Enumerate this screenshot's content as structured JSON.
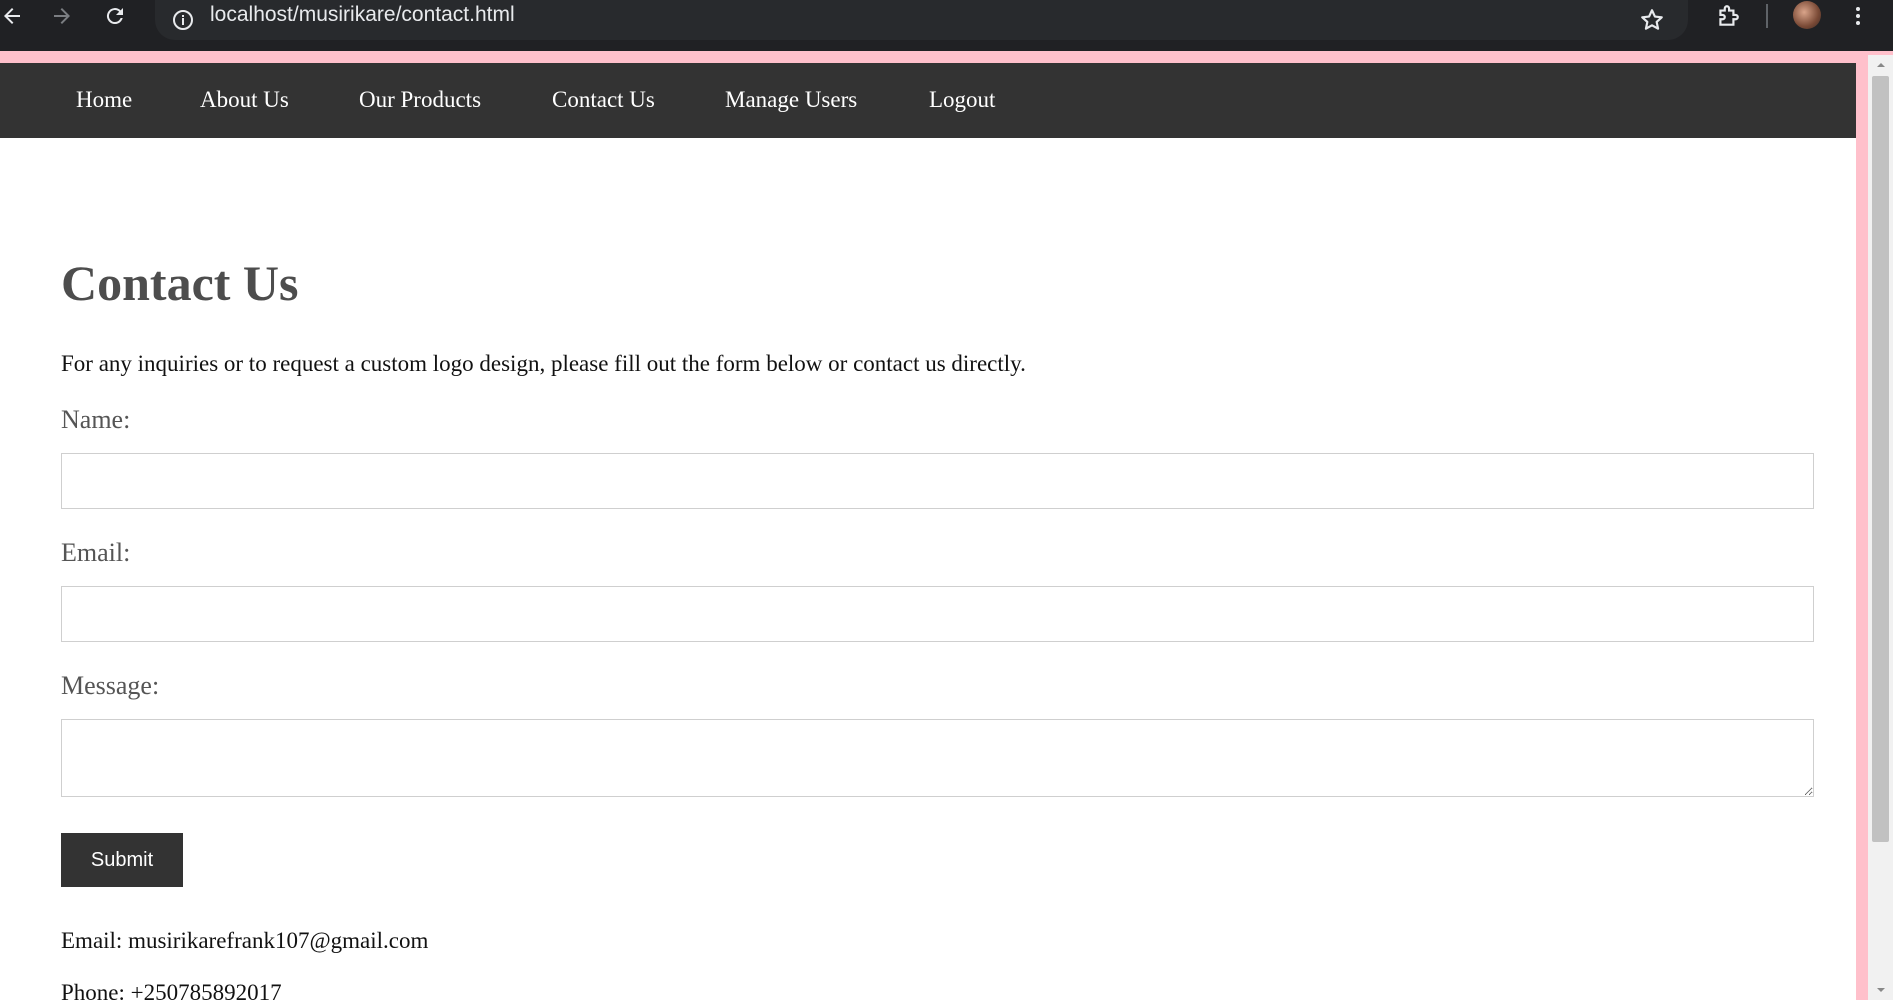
{
  "browser": {
    "url": "localhost/musirikare/contact.html",
    "icons": [
      "back-icon",
      "forward-icon",
      "reload-icon",
      "info-icon",
      "star-icon",
      "extensions-icon",
      "avatar",
      "menu-icon"
    ]
  },
  "nav": {
    "items": [
      {
        "label": "Home"
      },
      {
        "label": "About Us"
      },
      {
        "label": "Our Products"
      },
      {
        "label": "Contact Us"
      },
      {
        "label": "Manage Users"
      },
      {
        "label": "Logout"
      }
    ]
  },
  "main": {
    "title": "Contact Us",
    "intro": "For any inquiries or to request a custom logo design, please fill out the form below or contact us directly.",
    "form": {
      "name_label": "Name:",
      "name_value": "",
      "email_label": "Email:",
      "email_value": "",
      "message_label": "Message:",
      "message_value": "",
      "submit_label": "Submit"
    },
    "contact": {
      "email_line": "Email: musirikarefrank107@gmail.com",
      "phone_line": "Phone: +250785892017"
    }
  },
  "colors": {
    "page_border": "#ffc0cb",
    "nav_bg": "#333333",
    "button_bg": "#333333",
    "chrome_bg": "#202124"
  }
}
